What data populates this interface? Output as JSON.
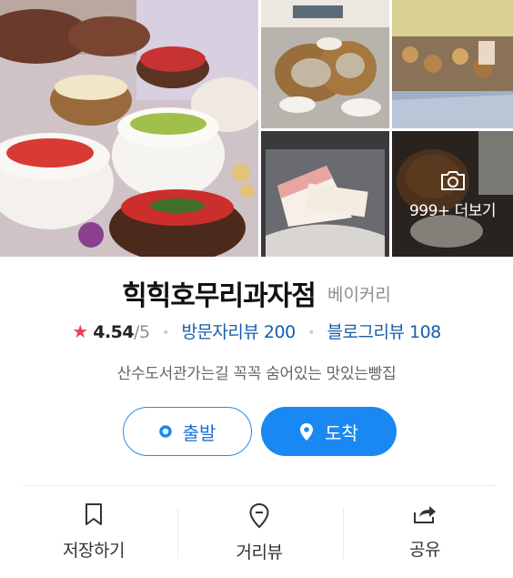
{
  "gallery": {
    "more_label": "999+ 더보기",
    "icons": {
      "more": "camera-icon"
    }
  },
  "place": {
    "name": "힉힉호무리과자점",
    "category": "베이커리",
    "rating": "4.54",
    "rating_max": "/5",
    "visitor_reviews_label": "방문자리뷰",
    "visitor_reviews_count": "200",
    "blog_reviews_label": "블로그리뷰",
    "blog_reviews_count": "108",
    "description": "산수도서관가는길 꼭꼭 숨어있는 맛있는빵집"
  },
  "route": {
    "depart_label": "출발",
    "arrive_label": "도착"
  },
  "actions": [
    {
      "label": "저장하기",
      "icon": "bookmark-icon"
    },
    {
      "label": "거리뷰",
      "icon": "location-pin-icon"
    },
    {
      "label": "공유",
      "icon": "share-icon"
    }
  ],
  "colors": {
    "accent_blue": "#1988f2",
    "link_blue": "#1a5dab",
    "star_red": "#e9405a"
  }
}
